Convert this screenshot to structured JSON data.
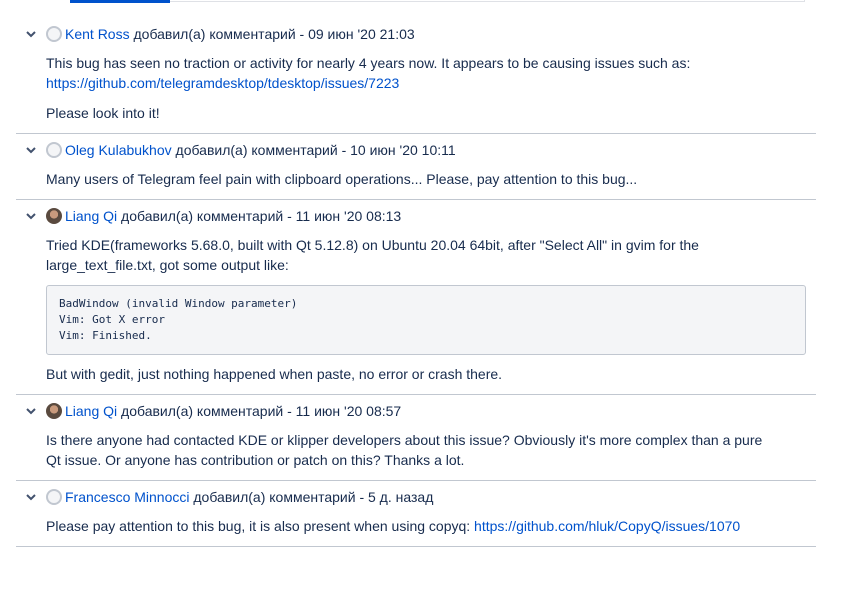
{
  "comments": [
    {
      "author": "Kent Ross",
      "action": " добавил(а) комментарий - ",
      "time": "09 июн '20 21:03",
      "avatar": "default",
      "p1": "This bug has seen no traction or activity for nearly 4 years now. It appears to be causing issues such as: ",
      "link": "https://github.com/telegramdesktop/tdesktop/issues/7223",
      "p2": "Please look into it!"
    },
    {
      "author": "Oleg Kulabukhov",
      "action": " добавил(а) комментарий - ",
      "time": "10 июн '20 10:11",
      "avatar": "default",
      "p1": "Many users of Telegram feel pain with clipboard operations... Please, pay attention to this bug..."
    },
    {
      "author": "Liang Qi",
      "action": " добавил(а) комментарий - ",
      "time": "11 июн '20 08:13",
      "avatar": "photo",
      "p1": "Tried KDE(frameworks 5.68.0, built with Qt 5.12.8) on Ubuntu 20.04 64bit, after \"Select All\" in gvim for the large_text_file.txt, got some output like:",
      "code": "BadWindow (invalid Window parameter)\nVim: Got X error\nVim: Finished.",
      "p2": "But with gedit, just nothing happened when paste, no error or crash there."
    },
    {
      "author": "Liang Qi",
      "action": " добавил(а) комментарий - ",
      "time": "11 июн '20 08:57",
      "avatar": "photo",
      "p1": "Is there anyone had contacted KDE or klipper developers about this issue? Obviously it's more complex than a pure Qt issue. Or anyone has contribution or patch on this? Thanks a lot."
    },
    {
      "author": "Francesco Minnocci",
      "action": " добавил(а) комментарий - ",
      "time": "5 д. назад",
      "avatar": "default",
      "p1": "Please pay attention to this bug, it is also present when using copyq: ",
      "link": "https://github.com/hluk/CopyQ/issues/1070"
    }
  ],
  "icons": {
    "collapse": "chevron-down-icon"
  }
}
